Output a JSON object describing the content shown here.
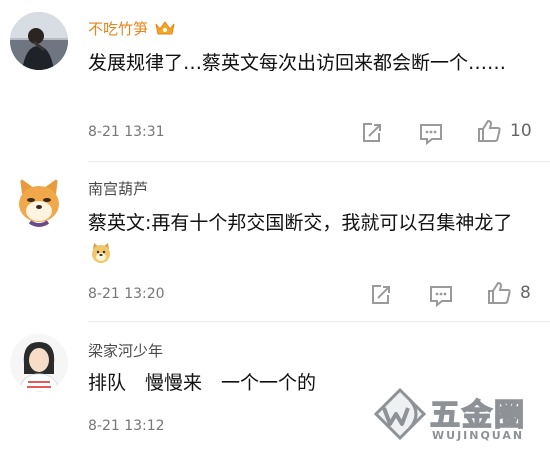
{
  "comments": [
    {
      "username": "不吃竹笋",
      "text": "发展规律了…蔡英文每次出访回来都会断一个……",
      "time": "8-21 13:31",
      "likes": "10",
      "username_color": "#e8841a",
      "vip_icon": "crown-icon"
    },
    {
      "username": "南宫葫芦",
      "text": "蔡英文:再有十个邦交国断交，我就可以召集神龙了",
      "emoji": "doge-emoji-icon",
      "time": "8-21 13:20",
      "likes": "8",
      "username_color": "#4a4a4a"
    },
    {
      "username": "梁家河少年",
      "text": "排队　慢慢来　一个一个的",
      "time": "8-21 13:12",
      "username_color": "#4a4a4a"
    }
  ],
  "watermark": {
    "text": "五金圈",
    "subtext": "WUJINQUAN"
  },
  "colors": {
    "accent": "#e8841a",
    "icon_gray": "#9a9a9a",
    "watermark": "#8e9297"
  }
}
